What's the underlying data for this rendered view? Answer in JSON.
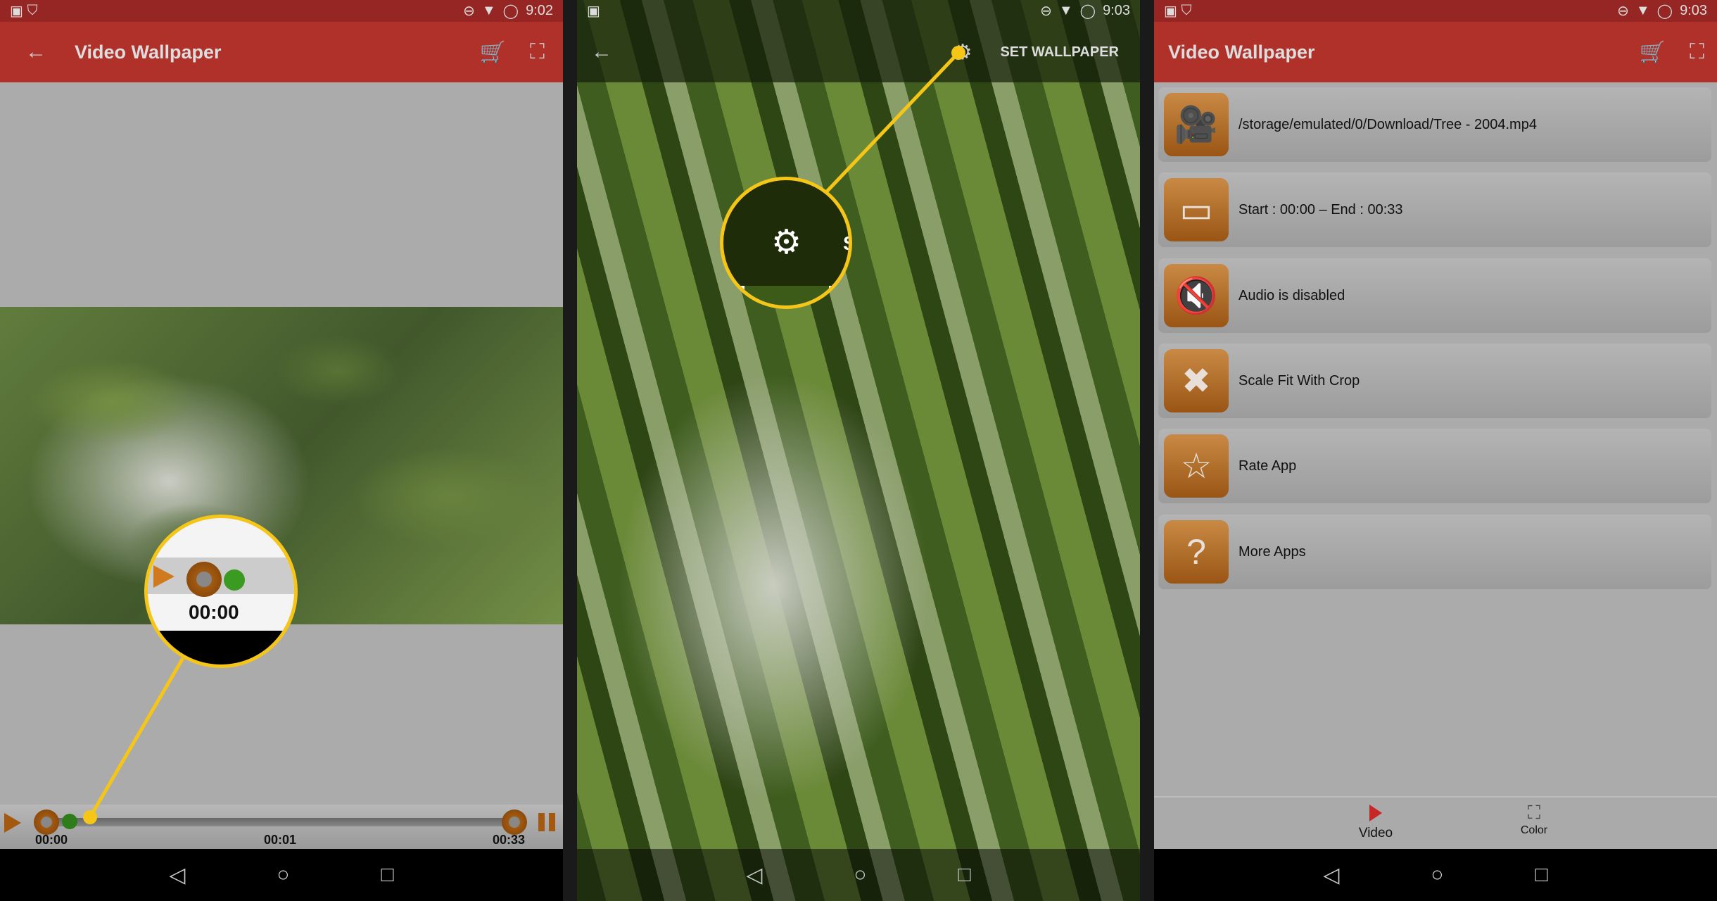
{
  "screen1": {
    "status_time": "9:02",
    "title": "Video Wallpaper",
    "start_time": "00:00",
    "mid_time": "00:01",
    "end_time": "00:33",
    "callout_time": "00:00"
  },
  "screen2": {
    "status_time": "9:03",
    "set_wallpaper": "SET WALLPAPER",
    "callout_letter": "S"
  },
  "screen3": {
    "status_time": "9:03",
    "title": "Video Wallpaper",
    "items": [
      {
        "label": "/storage/emulated/0/Download/Tree - 2004.mp4",
        "icon": "video-camera-icon"
      },
      {
        "label": "Start : 00:00 – End : 00:33",
        "icon": "trim-icon"
      },
      {
        "label": "Audio is disabled",
        "icon": "mute-icon"
      },
      {
        "label": "Scale Fit With Crop",
        "icon": "scale-icon"
      },
      {
        "label": "Rate App",
        "icon": "star-icon"
      },
      {
        "label": "More Apps",
        "icon": "question-icon"
      }
    ],
    "tabs": [
      {
        "label": "Video"
      },
      {
        "label": "Color"
      }
    ]
  },
  "colors": {
    "appbar": "#b0302a",
    "accent": "#f5c518",
    "icon_orange": "#b36a22"
  }
}
